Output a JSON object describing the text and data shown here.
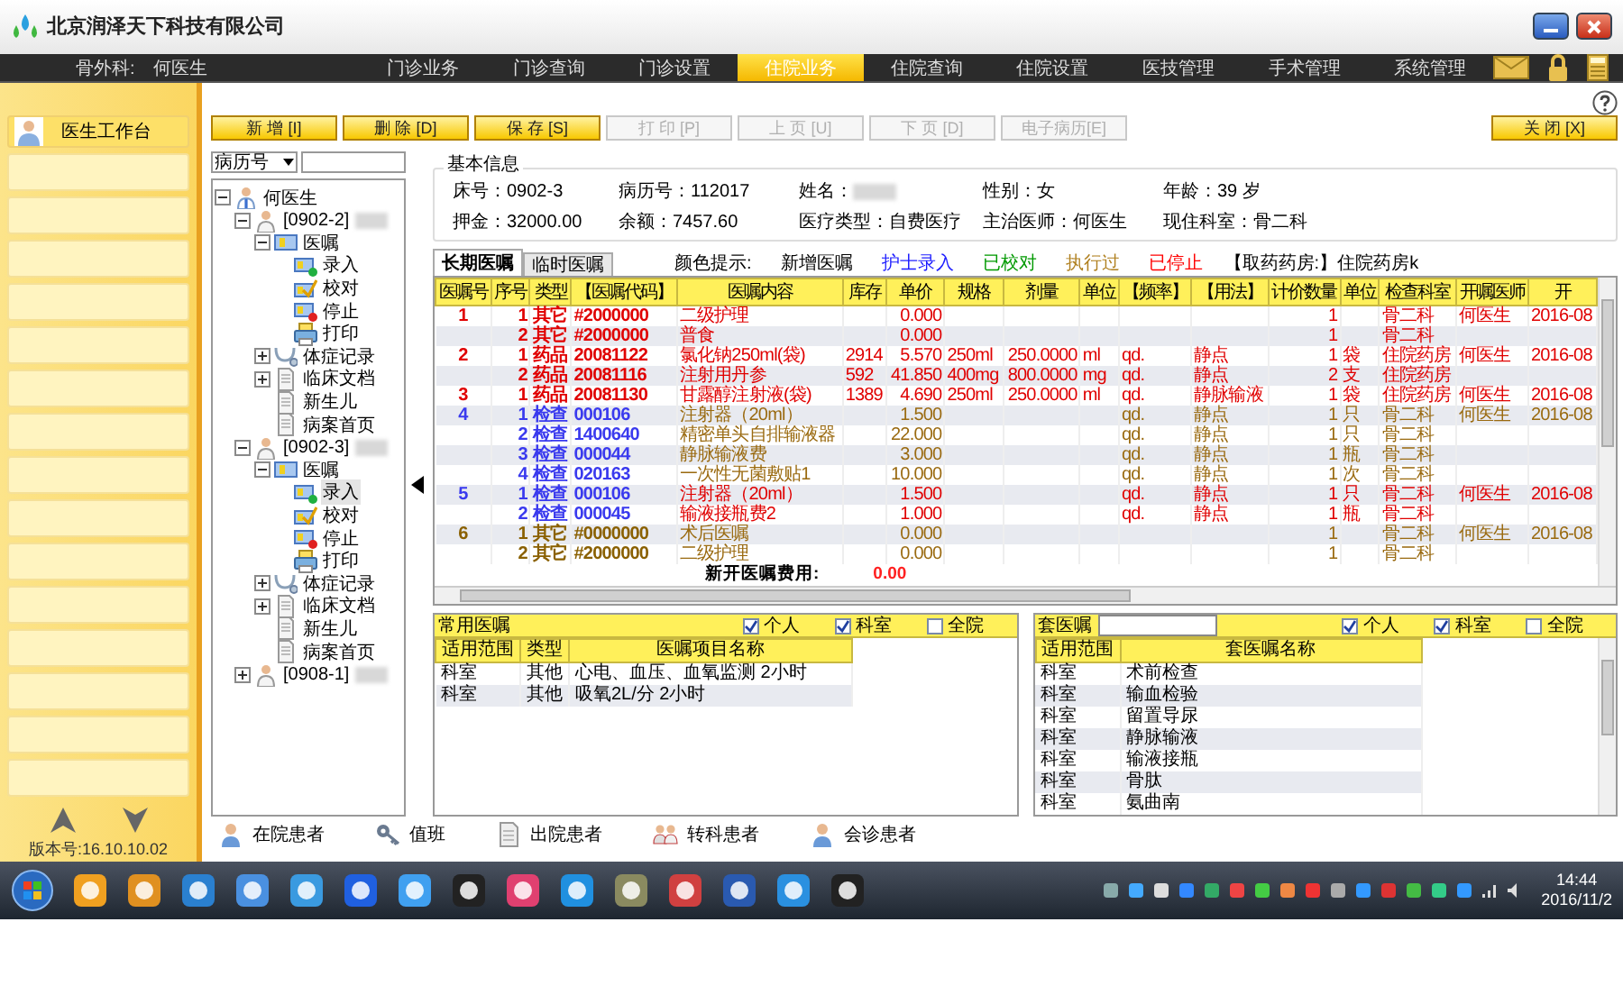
{
  "window": {
    "title": "北京润泽天下科技有限公司"
  },
  "menu_bar": {
    "department": "骨外科:",
    "user": "何医生",
    "items": [
      {
        "label": "门诊业务",
        "selected": false
      },
      {
        "label": "门诊查询",
        "selected": false
      },
      {
        "label": "门诊设置",
        "selected": false
      },
      {
        "label": "住院业务",
        "selected": true
      },
      {
        "label": "住院查询",
        "selected": false
      },
      {
        "label": "住院设置",
        "selected": false
      },
      {
        "label": "医技管理",
        "selected": false
      },
      {
        "label": "手术管理",
        "selected": false
      },
      {
        "label": "系统管理",
        "selected": false
      }
    ]
  },
  "sidebar": {
    "items": [
      {
        "label": "医生工作台",
        "selected": true
      }
    ],
    "version": "版本号:16.10.10.02"
  },
  "toolbar": {
    "buttons": [
      {
        "label": "新 增 [I]",
        "disabled": false
      },
      {
        "label": "删 除 [D]",
        "disabled": false
      },
      {
        "label": "保 存 [S]",
        "disabled": false
      },
      {
        "label": "打 印 [P]",
        "disabled": true
      },
      {
        "label": "上 页 [U]",
        "disabled": true
      },
      {
        "label": "下 页 [D]",
        "disabled": true
      },
      {
        "label": "电子病历[E]",
        "disabled": true
      }
    ],
    "close_button": {
      "label": "关 闭 [X]",
      "disabled": false
    }
  },
  "search": {
    "field": "病历号"
  },
  "tree": {
    "label": "何医生",
    "kind": "doctor",
    "expanded": true,
    "selected": false,
    "children": [
      {
        "label": "[0902-2]",
        "kind": "patient",
        "redacted": true,
        "expanded": true,
        "selected": false,
        "children": [
          {
            "label": "医嘱",
            "kind": "orders",
            "expanded": true,
            "selected": false,
            "children": [
              {
                "label": "录入",
                "kind": "entry",
                "selected": false
              },
              {
                "label": "校对",
                "kind": "check",
                "selected": false
              },
              {
                "label": "停止",
                "kind": "stop",
                "selected": false
              },
              {
                "label": "打印",
                "kind": "print",
                "selected": false
              }
            ]
          },
          {
            "label": "体症记录",
            "kind": "vitals",
            "expanded": false,
            "selected": false
          },
          {
            "label": "临床文档",
            "kind": "document",
            "expanded": false,
            "selected": false
          },
          {
            "label": "新生儿",
            "kind": "document",
            "selected": false
          },
          {
            "label": "病案首页",
            "kind": "document",
            "selected": false
          }
        ]
      },
      {
        "label": "[0902-3]",
        "kind": "patient",
        "redacted": true,
        "expanded": true,
        "selected": false,
        "children": [
          {
            "label": "医嘱",
            "kind": "orders",
            "expanded": true,
            "selected": false,
            "children": [
              {
                "label": "录入",
                "kind": "entry",
                "selected": true
              },
              {
                "label": "校对",
                "kind": "check",
                "selected": false
              },
              {
                "label": "停止",
                "kind": "stop",
                "selected": false
              },
              {
                "label": "打印",
                "kind": "print",
                "selected": false
              }
            ]
          },
          {
            "label": "体症记录",
            "kind": "vitals",
            "expanded": false,
            "selected": false
          },
          {
            "label": "临床文档",
            "kind": "document",
            "expanded": false,
            "selected": false
          },
          {
            "label": "新生儿",
            "kind": "document",
            "selected": false
          },
          {
            "label": "病案首页",
            "kind": "document",
            "selected": false
          }
        ]
      },
      {
        "label": "[0908-1]",
        "kind": "patient",
        "redacted": true,
        "expanded": false,
        "selected": false
      }
    ]
  },
  "patient_info": {
    "title": "基本信息",
    "fields": [
      {
        "label": "床号：",
        "value": "0902-3"
      },
      {
        "label": "病历号：",
        "value": "112017"
      },
      {
        "label": "姓名：",
        "redacted": true
      },
      {
        "label": "性别：",
        "value": "女"
      },
      {
        "label": "年龄：",
        "value": "39 岁"
      },
      {
        "label": "押金：",
        "value": "32000.00"
      },
      {
        "label": "余额：",
        "value": "7457.60"
      },
      {
        "label": "医疗类型：",
        "value": "自费医疗"
      },
      {
        "label": "主治医师：",
        "value": "何医生"
      },
      {
        "label": "现住科室：",
        "value": "骨二科"
      }
    ]
  },
  "tabs": [
    {
      "label": "长期医嘱",
      "selected": true
    },
    {
      "label": "临时医嘱",
      "selected": false
    }
  ],
  "legend": {
    "label": "颜色提示:",
    "items": [
      {
        "label": "新增医嘱",
        "color": "#000000"
      },
      {
        "label": "护士录入",
        "color": "#1a1aff"
      },
      {
        "label": "已校对",
        "color": "#009900"
      },
      {
        "label": "执行过",
        "color": "#b08020"
      },
      {
        "label": "已停止",
        "color": "#ff0000"
      }
    ]
  },
  "pharmacy": {
    "label": "【取药药房:】",
    "value": "住院药房k"
  },
  "orders_table": {
    "columns": [
      "医嘱号",
      "序号",
      "类型",
      "【医嘱代码】",
      "医嘱内容",
      "库存",
      "单价",
      "规格",
      "剂量",
      "单位",
      "【频率】",
      "【用法】",
      "计价数量",
      "单位",
      "检查科室",
      "开嘱医师",
      "开"
    ],
    "rows": [
      {
        "order": {
          "color": "#e00000",
          "cells": [
            "1",
            "1",
            "其它",
            "#2000000"
          ]
        },
        "detail": {
          "color": "#e00000",
          "cells": [
            "二级护理",
            "",
            "0.000",
            "",
            "",
            "",
            "",
            "",
            "1",
            "",
            "骨二科",
            "何医生",
            "2016-08"
          ]
        }
      },
      {
        "order": {
          "color": "#e00000",
          "cells": [
            "",
            "2",
            "其它",
            "#2000000"
          ]
        },
        "detail": {
          "color": "#e00000",
          "cells": [
            "普食",
            "",
            "0.000",
            "",
            "",
            "",
            "",
            "",
            "1",
            "",
            "骨二科",
            "",
            ""
          ]
        }
      },
      {
        "order": {
          "color": "#e00000",
          "cells": [
            "2",
            "1",
            "药品",
            "20081122"
          ]
        },
        "detail": {
          "color": "#e00000",
          "cells": [
            "氯化钠250ml(袋)",
            "2914",
            "5.570",
            "250ml",
            "250.0000",
            "ml",
            "qd.",
            "静点",
            "1",
            "袋",
            "住院药房",
            "何医生",
            "2016-08"
          ]
        }
      },
      {
        "order": {
          "color": "#e00000",
          "cells": [
            "",
            "2",
            "药品",
            "20081116"
          ]
        },
        "detail": {
          "color": "#e00000",
          "cells": [
            "注射用丹参",
            "592",
            "41.850",
            "400mg",
            "800.0000",
            "mg",
            "qd.",
            "静点",
            "2",
            "支",
            "住院药房",
            "",
            ""
          ]
        }
      },
      {
        "order": {
          "color": "#e00000",
          "cells": [
            "3",
            "1",
            "药品",
            "20081130"
          ]
        },
        "detail": {
          "color": "#e00000",
          "cells": [
            "甘露醇注射液(袋)",
            "1389",
            "4.690",
            "250ml",
            "250.0000",
            "ml",
            "qd.",
            "静脉输液",
            "1",
            "袋",
            "住院药房",
            "何医生",
            "2016-08"
          ]
        }
      },
      {
        "order": {
          "color": "#3a3aee",
          "cells": [
            "4",
            "1",
            "检查",
            "000106"
          ]
        },
        "detail": {
          "color": "#9a6a10",
          "cells": [
            "注射器（20ml）",
            "",
            "1.500",
            "",
            "",
            "",
            "qd.",
            "静点",
            "1",
            "只",
            "骨二科",
            "何医生",
            "2016-08"
          ]
        }
      },
      {
        "order": {
          "color": "#3a3aee",
          "cells": [
            "",
            "2",
            "检查",
            "1400640"
          ]
        },
        "detail": {
          "color": "#9a6a10",
          "cells": [
            "精密单头自排输液器",
            "",
            "22.000",
            "",
            "",
            "",
            "qd.",
            "静点",
            "1",
            "只",
            "骨二科",
            "",
            ""
          ]
        }
      },
      {
        "order": {
          "color": "#3a3aee",
          "cells": [
            "",
            "3",
            "检查",
            "000044"
          ]
        },
        "detail": {
          "color": "#9a6a10",
          "cells": [
            "静脉输液费",
            "",
            "3.000",
            "",
            "",
            "",
            "qd.",
            "静点",
            "1",
            "瓶",
            "骨二科",
            "",
            ""
          ]
        }
      },
      {
        "order": {
          "color": "#3a3aee",
          "cells": [
            "",
            "4",
            "检查",
            "020163"
          ]
        },
        "detail": {
          "color": "#9a6a10",
          "cells": [
            "一次性无菌敷贴1",
            "",
            "10.000",
            "",
            "",
            "",
            "qd.",
            "静点",
            "1",
            "次",
            "骨二科",
            "",
            ""
          ]
        }
      },
      {
        "order": {
          "color": "#3a3aee",
          "cells": [
            "5",
            "1",
            "检查",
            "000106"
          ]
        },
        "detail": {
          "color": "#e00000",
          "cells": [
            "注射器（20ml）",
            "",
            "1.500",
            "",
            "",
            "",
            "qd.",
            "静点",
            "1",
            "只",
            "骨二科",
            "何医生",
            "2016-08"
          ]
        }
      },
      {
        "order": {
          "color": "#3a3aee",
          "cells": [
            "",
            "2",
            "检查",
            "000045"
          ]
        },
        "detail": {
          "color": "#e00000",
          "cells": [
            "输液接瓶费2",
            "",
            "1.000",
            "",
            "",
            "",
            "qd.",
            "静点",
            "1",
            "瓶",
            "骨二科",
            "",
            ""
          ]
        }
      },
      {
        "order": {
          "color": "#8a6000",
          "cells": [
            "6",
            "1",
            "其它",
            "#0000000"
          ]
        },
        "detail": {
          "color": "#9a6a10",
          "cells": [
            "术后医嘱",
            "",
            "0.000",
            "",
            "",
            "",
            "",
            "",
            "1",
            "",
            "骨二科",
            "何医生",
            "2016-08"
          ]
        }
      },
      {
        "order": {
          "color": "#8a6000",
          "cells": [
            "",
            "2",
            "其它",
            "#2000000"
          ]
        },
        "detail": {
          "color": "#9a6a10",
          "cells": [
            "二级护理",
            "",
            "0.000",
            "",
            "",
            "",
            "",
            "",
            "1",
            "",
            "骨二科",
            "",
            ""
          ]
        }
      }
    ],
    "footer_label": "新开医嘱费用:",
    "footer_value": "0.00"
  },
  "common_orders": {
    "title": "常用医嘱",
    "filters": [
      {
        "label": "个人",
        "checked": true
      },
      {
        "label": "科室",
        "checked": true
      },
      {
        "label": "全院",
        "checked": false
      }
    ],
    "columns": [
      "适用范围",
      "类型",
      "医嘱项目名称"
    ],
    "rows": [
      [
        "科室",
        "其他",
        "心电、血压、血氧监测 2小时"
      ],
      [
        "科室",
        "其他",
        "吸氧2L/分 2小时"
      ]
    ]
  },
  "order_sets": {
    "title": "套医嘱",
    "filters": [
      {
        "label": "个人",
        "checked": true
      },
      {
        "label": "科室",
        "checked": true
      },
      {
        "label": "全院",
        "checked": false
      }
    ],
    "columns": [
      "适用范围",
      "套医嘱名称"
    ],
    "rows": [
      [
        "科室",
        "术前检查"
      ],
      [
        "科室",
        "输血检验"
      ],
      [
        "科室",
        "留置导尿"
      ],
      [
        "科室",
        "静脉输液"
      ],
      [
        "科室",
        "输液接瓶"
      ],
      [
        "科室",
        "骨肽"
      ],
      [
        "科室",
        "氨曲南"
      ]
    ]
  },
  "bottom_nav": [
    {
      "label": "在院患者",
      "kind": "person"
    },
    {
      "label": "值班",
      "kind": "key"
    },
    {
      "label": "出院患者",
      "kind": "document"
    },
    {
      "label": "转科患者",
      "kind": "people"
    },
    {
      "label": "会诊患者",
      "kind": "person"
    }
  ],
  "taskbar": {
    "time": "14:44",
    "date": "2016/11/2"
  }
}
